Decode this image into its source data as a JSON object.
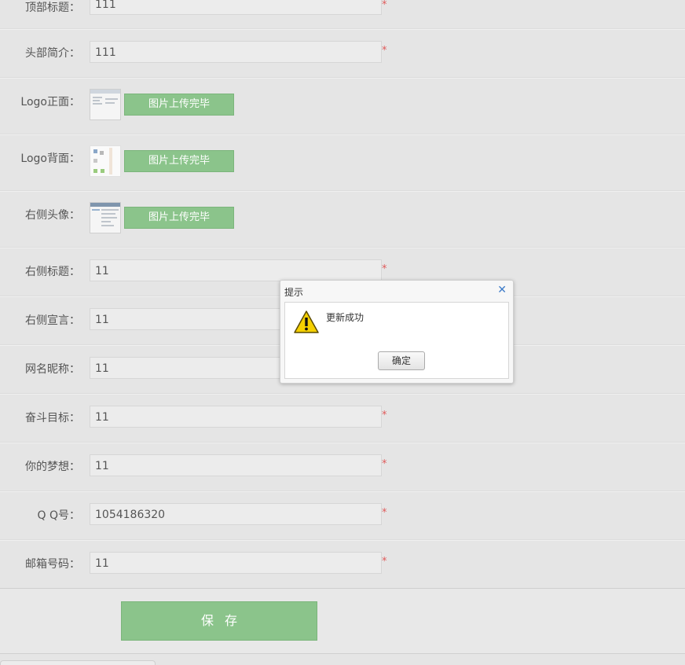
{
  "form": {
    "rows": [
      {
        "label": "顶部标题：",
        "value": "111",
        "required": "*"
      },
      {
        "label": "头部简介：",
        "value": "111",
        "required": "*"
      },
      {
        "label": "Logo正面：",
        "upload": "图片上传完毕"
      },
      {
        "label": "Logo背面：",
        "upload": "图片上传完毕"
      },
      {
        "label": "右侧头像：",
        "upload": "图片上传完毕"
      },
      {
        "label": "右侧标题：",
        "value": "11",
        "required": "*"
      },
      {
        "label": "右侧宣言：",
        "value": "11"
      },
      {
        "label": "网名昵称：",
        "value": "11"
      },
      {
        "label": "奋斗目标：",
        "value": "11",
        "required": "*"
      },
      {
        "label": "你的梦想：",
        "value": "11",
        "required": "*"
      },
      {
        "label": "Q Q号：",
        "value": "1054186320",
        "required": "*"
      },
      {
        "label": "邮箱号码：",
        "value": "11",
        "required": "*"
      }
    ],
    "save_label": "保存"
  },
  "dialog": {
    "title": "提示",
    "close_icon": "close-icon",
    "icon": "warning-icon",
    "message": "更新成功",
    "ok_label": "确定"
  },
  "colors": {
    "accent_green": "#8bc48b",
    "required_red": "#e05a5a",
    "close_blue": "#3d7bc8"
  }
}
